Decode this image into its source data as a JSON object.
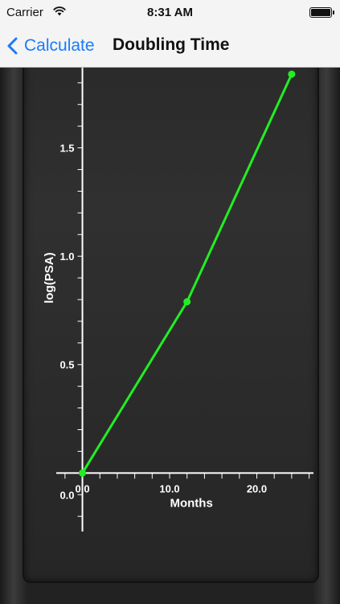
{
  "status_bar": {
    "carrier": "Carrier",
    "time": "8:31 AM"
  },
  "nav": {
    "back_label": "Calculate",
    "title": "Doubling Time",
    "back_icon": "chevron-left-icon"
  },
  "colors": {
    "accent": "#1a7cf5",
    "line": "#22ee22",
    "axis": "#ffffff",
    "background": "#222222"
  },
  "chart_data": {
    "type": "line",
    "xlabel": "Months",
    "ylabel": "log(PSA)",
    "x_ticks": [
      "0.0",
      "10.0",
      "20.0"
    ],
    "y_ticks": [
      "0.5",
      "1.0",
      "1.5"
    ],
    "y_origin_label": "0.0",
    "xlim": [
      -3,
      26.5
    ],
    "ylim": [
      -0.27,
      1.87
    ],
    "grid": false,
    "series": [
      {
        "x": [
          0,
          12,
          24
        ],
        "y": [
          0,
          0.79,
          1.84
        ]
      }
    ]
  }
}
